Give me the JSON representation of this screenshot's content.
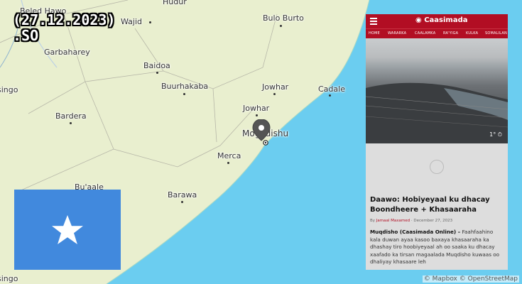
{
  "date_label": "(27.12.2023)",
  "country_code": ".SO",
  "cities": [
    {
      "name": "Beled Hawo",
      "id": "beled-hawo"
    },
    {
      "name": "Hudur",
      "id": "hudur"
    },
    {
      "name": "Wajid",
      "id": "wajid"
    },
    {
      "name": "Bulo Burto",
      "id": "bulo-burto"
    },
    {
      "name": "Garbaharey",
      "id": "garbaharey"
    },
    {
      "name": "Baidoa",
      "id": "baidoa"
    },
    {
      "name": "Buurhakaba",
      "id": "buurhakaba"
    },
    {
      "name": "Jowhar",
      "id": "jowhar"
    },
    {
      "name": "Cadale",
      "id": "cadale"
    },
    {
      "name": "Jowhar",
      "id": "jowhar-2"
    },
    {
      "name": "Bardera",
      "id": "bardera"
    },
    {
      "name": "Mogadishu",
      "id": "mogadishu"
    },
    {
      "name": "Merca",
      "id": "merca"
    },
    {
      "name": "Bu'aale",
      "id": "buaale"
    },
    {
      "name": "Barawa",
      "id": "barawa"
    },
    {
      "name": "singo",
      "id": "singo"
    },
    {
      "name": "singo",
      "id": "singo-2"
    }
  ],
  "flag": {
    "field_color": "#4189dd",
    "star_color": "#ffffff"
  },
  "attribution": "© Mapbox © OpenStreetMap",
  "article": {
    "brand": "Caasimada",
    "nav": [
      "HOME",
      "WARARKA",
      "CAALAMKA",
      "RA'YIGA",
      "KUL​KA",
      "SOMALILAN"
    ],
    "photo_caption": "1°",
    "headline": "Daawo: Hobiyeyaal ku dhacay Boondheere + Khasaaraha",
    "byline_prefix": "By",
    "author": "Jamaal Maxamed",
    "date": "December 27, 2023",
    "lead": "Muqdisho (Caasimada Online) –",
    "body": "Faahfaahino kala duwan ayaa kasoo baxaya khasaaraha ka dhashay tiro hoobiyeyaal ah oo saaka ku dhacay xaafado ka tirsan magaalada Muqdisho kuwaas oo dhaliyay khasaare leh"
  },
  "colors": {
    "sea": "#6bcdf0",
    "land": "#e9efcf",
    "accent": "#b20e23"
  }
}
